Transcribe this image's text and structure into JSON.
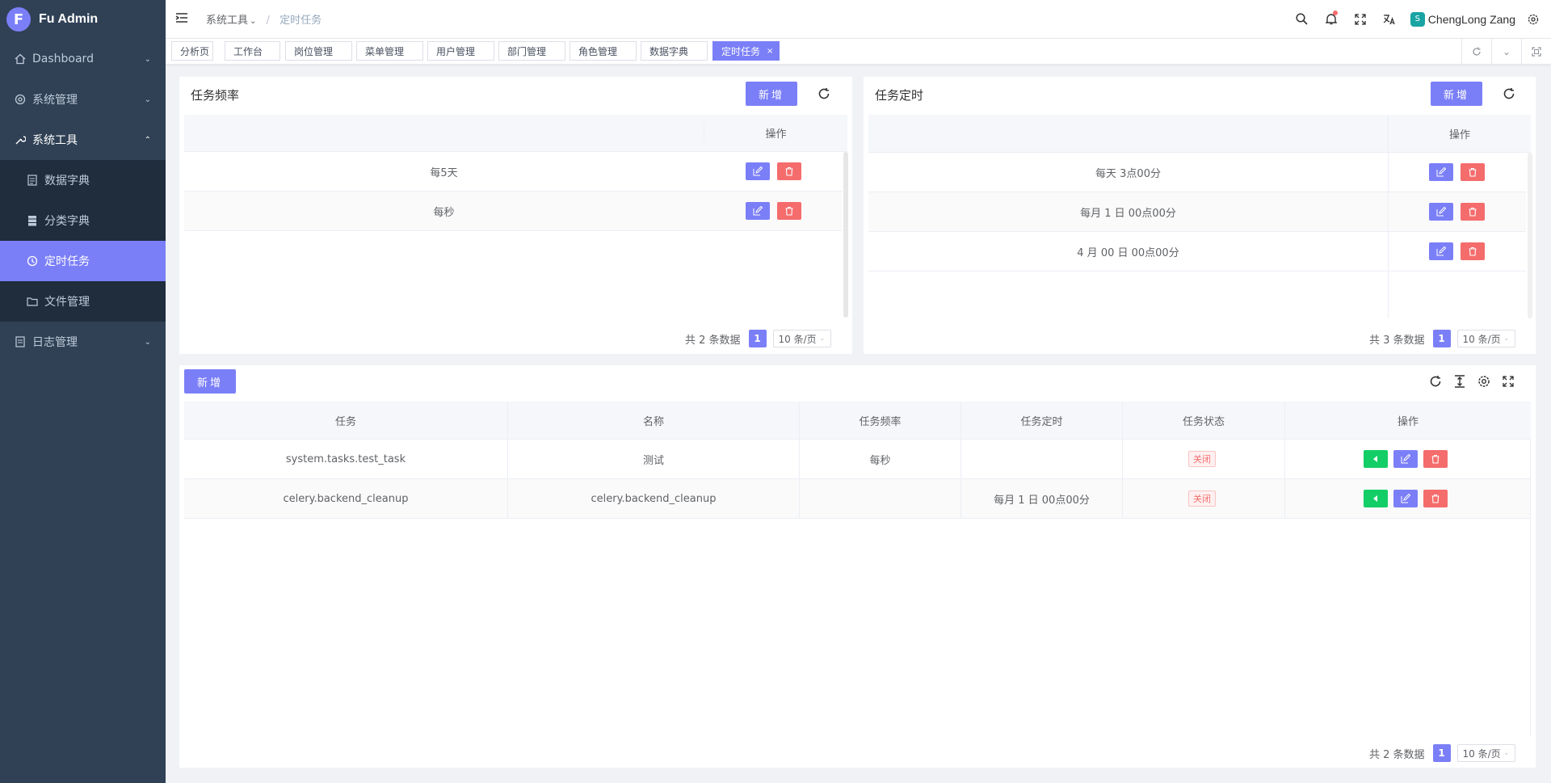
{
  "app": {
    "title": "Fu Admin"
  },
  "sidebar": {
    "items": [
      {
        "label": "Dashboard"
      },
      {
        "label": "系统管理"
      },
      {
        "label": "系统工具"
      },
      {
        "label": "日志管理"
      }
    ],
    "subitems": [
      {
        "label": "数据字典"
      },
      {
        "label": "分类字典"
      },
      {
        "label": "定时任务"
      },
      {
        "label": "文件管理"
      }
    ]
  },
  "header": {
    "breadcrumb": [
      "系统工具",
      "定时任务"
    ],
    "username": "ChengLong Zang"
  },
  "tags": [
    {
      "label": "分析页"
    },
    {
      "label": "工作台"
    },
    {
      "label": "岗位管理"
    },
    {
      "label": "菜单管理"
    },
    {
      "label": "用户管理"
    },
    {
      "label": "部门管理"
    },
    {
      "label": "角色管理"
    },
    {
      "label": "数据字典"
    },
    {
      "label": "定时任务",
      "close": "×"
    }
  ],
  "freq": {
    "title": "任务频率",
    "add_label": "新增",
    "op_header": "操作",
    "rows": [
      "每5天",
      "每秒"
    ],
    "total": "共 2 条数据",
    "page": "1",
    "page_size": "10 条/页"
  },
  "cron": {
    "title": "任务定时",
    "add_label": "新增",
    "op_header": "操作",
    "rows": [
      "每天 3点00分",
      "每月 1 日 00点00分",
      "4 月 00 日 00点00分"
    ],
    "total": "共 3 条数据",
    "page": "1",
    "page_size": "10 条/页"
  },
  "tasks": {
    "add_label": "新增",
    "columns": [
      "任务",
      "名称",
      "任务频率",
      "任务定时",
      "任务状态",
      "操作"
    ],
    "rows": [
      {
        "task": "system.tasks.test_task",
        "name": "测试",
        "freq": "每秒",
        "cron": "",
        "status": "关闭"
      },
      {
        "task": "celery.backend_cleanup",
        "name": "celery.backend_cleanup",
        "freq": "",
        "cron": "每月 1 日 00点00分",
        "status": "关闭"
      }
    ],
    "total": "共 2 条数据",
    "page": "1",
    "page_size": "10 条/页"
  },
  "colors": {
    "primary": "#7b7ff7",
    "danger": "#f56c6c",
    "success": "#13ce66",
    "sidebar": "#304156"
  }
}
